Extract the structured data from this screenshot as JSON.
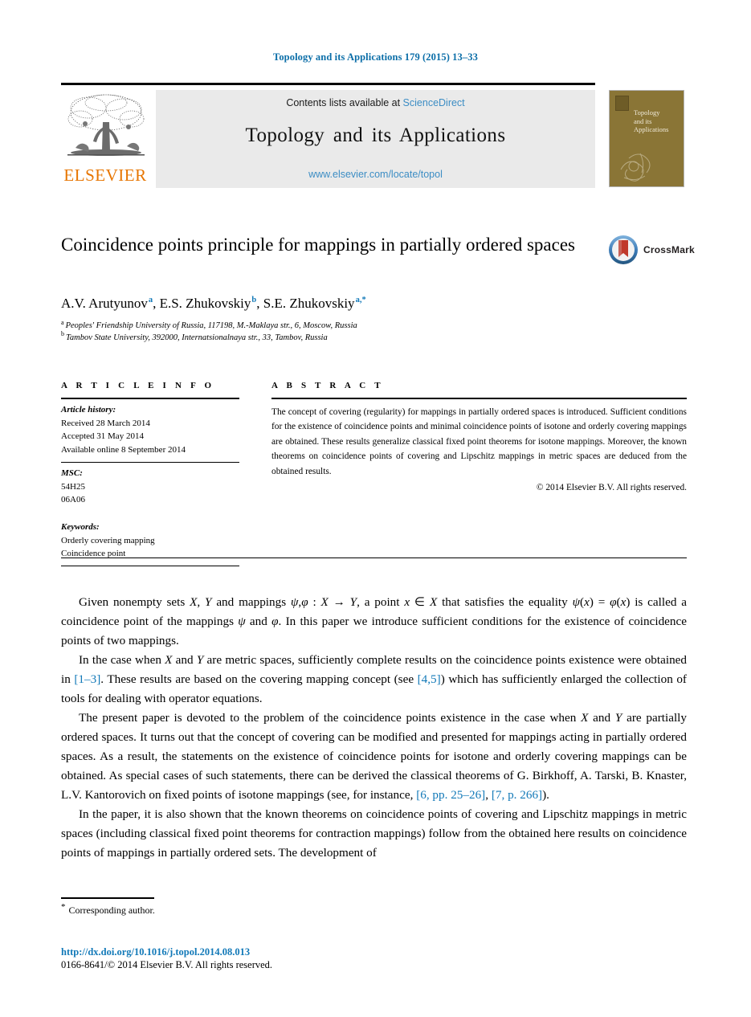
{
  "running_head": "Topology and its Applications 179 (2015) 13–33",
  "banner": {
    "contents_text": "Contents lists available at ",
    "sciencedirect": "ScienceDirect",
    "journal_title": "Topology and its Applications",
    "url": "www.elsevier.com/locate/topol",
    "publisher_wordmark": "ELSEVIER",
    "publisher_logo_icon": "elsevier-tree-logo"
  },
  "cover": {
    "title_line1": "Topology",
    "title_line2": "and its",
    "title_line3": "Applications"
  },
  "crossmark": {
    "label": "CrossMark",
    "icon": "crossmark-badge-icon"
  },
  "article": {
    "title": "Coincidence points principle for mappings in partially ordered spaces",
    "authors_html": "A.V. Arutyunov <sup>a</sup>, E.S. Zhukovskiy <sup>b</sup>, S.E. Zhukovskiy <sup>a,*</sup>",
    "affiliation_a": "Peoples' Friendship University of Russia, 117198, M.-Maklaya str., 6, Moscow, Russia",
    "affiliation_b": "Tambov State University, 392000, Internatsionalnaya str., 33, Tambov, Russia",
    "affiliation_a_marker": "a",
    "affiliation_b_marker": "b"
  },
  "info": {
    "heading": "A R T I C L E   I N F O",
    "history_label": "Article history:",
    "history": [
      "Received 28 March 2014",
      "Accepted 31 May 2014",
      "Available online 8 September 2014"
    ],
    "msc_label": "MSC:",
    "msc": [
      "54H25",
      "06A06"
    ],
    "keywords_label": "Keywords:",
    "keywords": [
      "Orderly covering mapping",
      "Coincidence point"
    ]
  },
  "abstract": {
    "heading": "A B S T R A C T",
    "text": "The concept of covering (regularity) for mappings in partially ordered spaces is introduced. Sufficient conditions for the existence of coincidence points and minimal coincidence points of isotone and orderly covering mappings are obtained. These results generalize classical fixed point theorems for isotone mappings. Moreover, the known theorems on coincidence points of covering and Lipschitz mappings in metric spaces are deduced from the obtained results.",
    "copyright": "© 2014 Elsevier B.V. All rights reserved."
  },
  "body": {
    "p1_a": "Given nonempty sets ",
    "p1_b": ", ",
    "p1_c": " and mappings ",
    "p1_full": "Given nonempty sets X, Y and mappings ψ,φ : X → Y, a point x ∈ X that satisfies the equality ψ(x) = φ(x) is called a coincidence point of the mappings ψ and φ. In this paper we introduce sufficient conditions for the existence of coincidence points of two mappings.",
    "p2_pre": "In the case when X and Y are metric spaces, sufficiently complete results on the coincidence points existence were obtained in ",
    "p2_cite1": "[1–3]",
    "p2_mid": ". These results are based on the covering mapping concept (see ",
    "p2_cite2": "[4,5]",
    "p2_post": ") which has sufficiently enlarged the collection of tools for dealing with operator equations.",
    "p3": "The present paper is devoted to the problem of the coincidence points existence in the case when X and Y are partially ordered spaces. It turns out that the concept of covering can be modified and presented for mappings acting in partially ordered spaces. As a result, the statements on the existence of coincidence points for isotone and orderly covering mappings can be obtained. As special cases of such statements, there can be derived the classical theorems of G. Birkhoff, A. Tarski, B. Knaster, L.V. Kantorovich on fixed points of isotone mappings (see, for instance, ",
    "p3_cite1": "[6, pp. 25–26]",
    "p3_mid": ", ",
    "p3_cite2": "[7, p. 266]",
    "p3_post": ").",
    "p4": "In the paper, it is also shown that the known theorems on coincidence points of covering and Lipschitz mappings in metric spaces (including classical fixed point theorems for contraction mappings) follow from the obtained here results on coincidence points of mappings in partially ordered sets. The development of"
  },
  "footer": {
    "corresponding_marker": "*",
    "corresponding": "Corresponding author.",
    "doi": "http://dx.doi.org/10.1016/j.topol.2014.08.013",
    "issn": "0166-8641/© 2014 Elsevier B.V. All rights reserved."
  },
  "colors": {
    "link_blue": "#1279b8",
    "banner_link_blue": "#3c8dc4",
    "elsevier_orange": "#E77500",
    "cover_olive": "#8a7536"
  }
}
